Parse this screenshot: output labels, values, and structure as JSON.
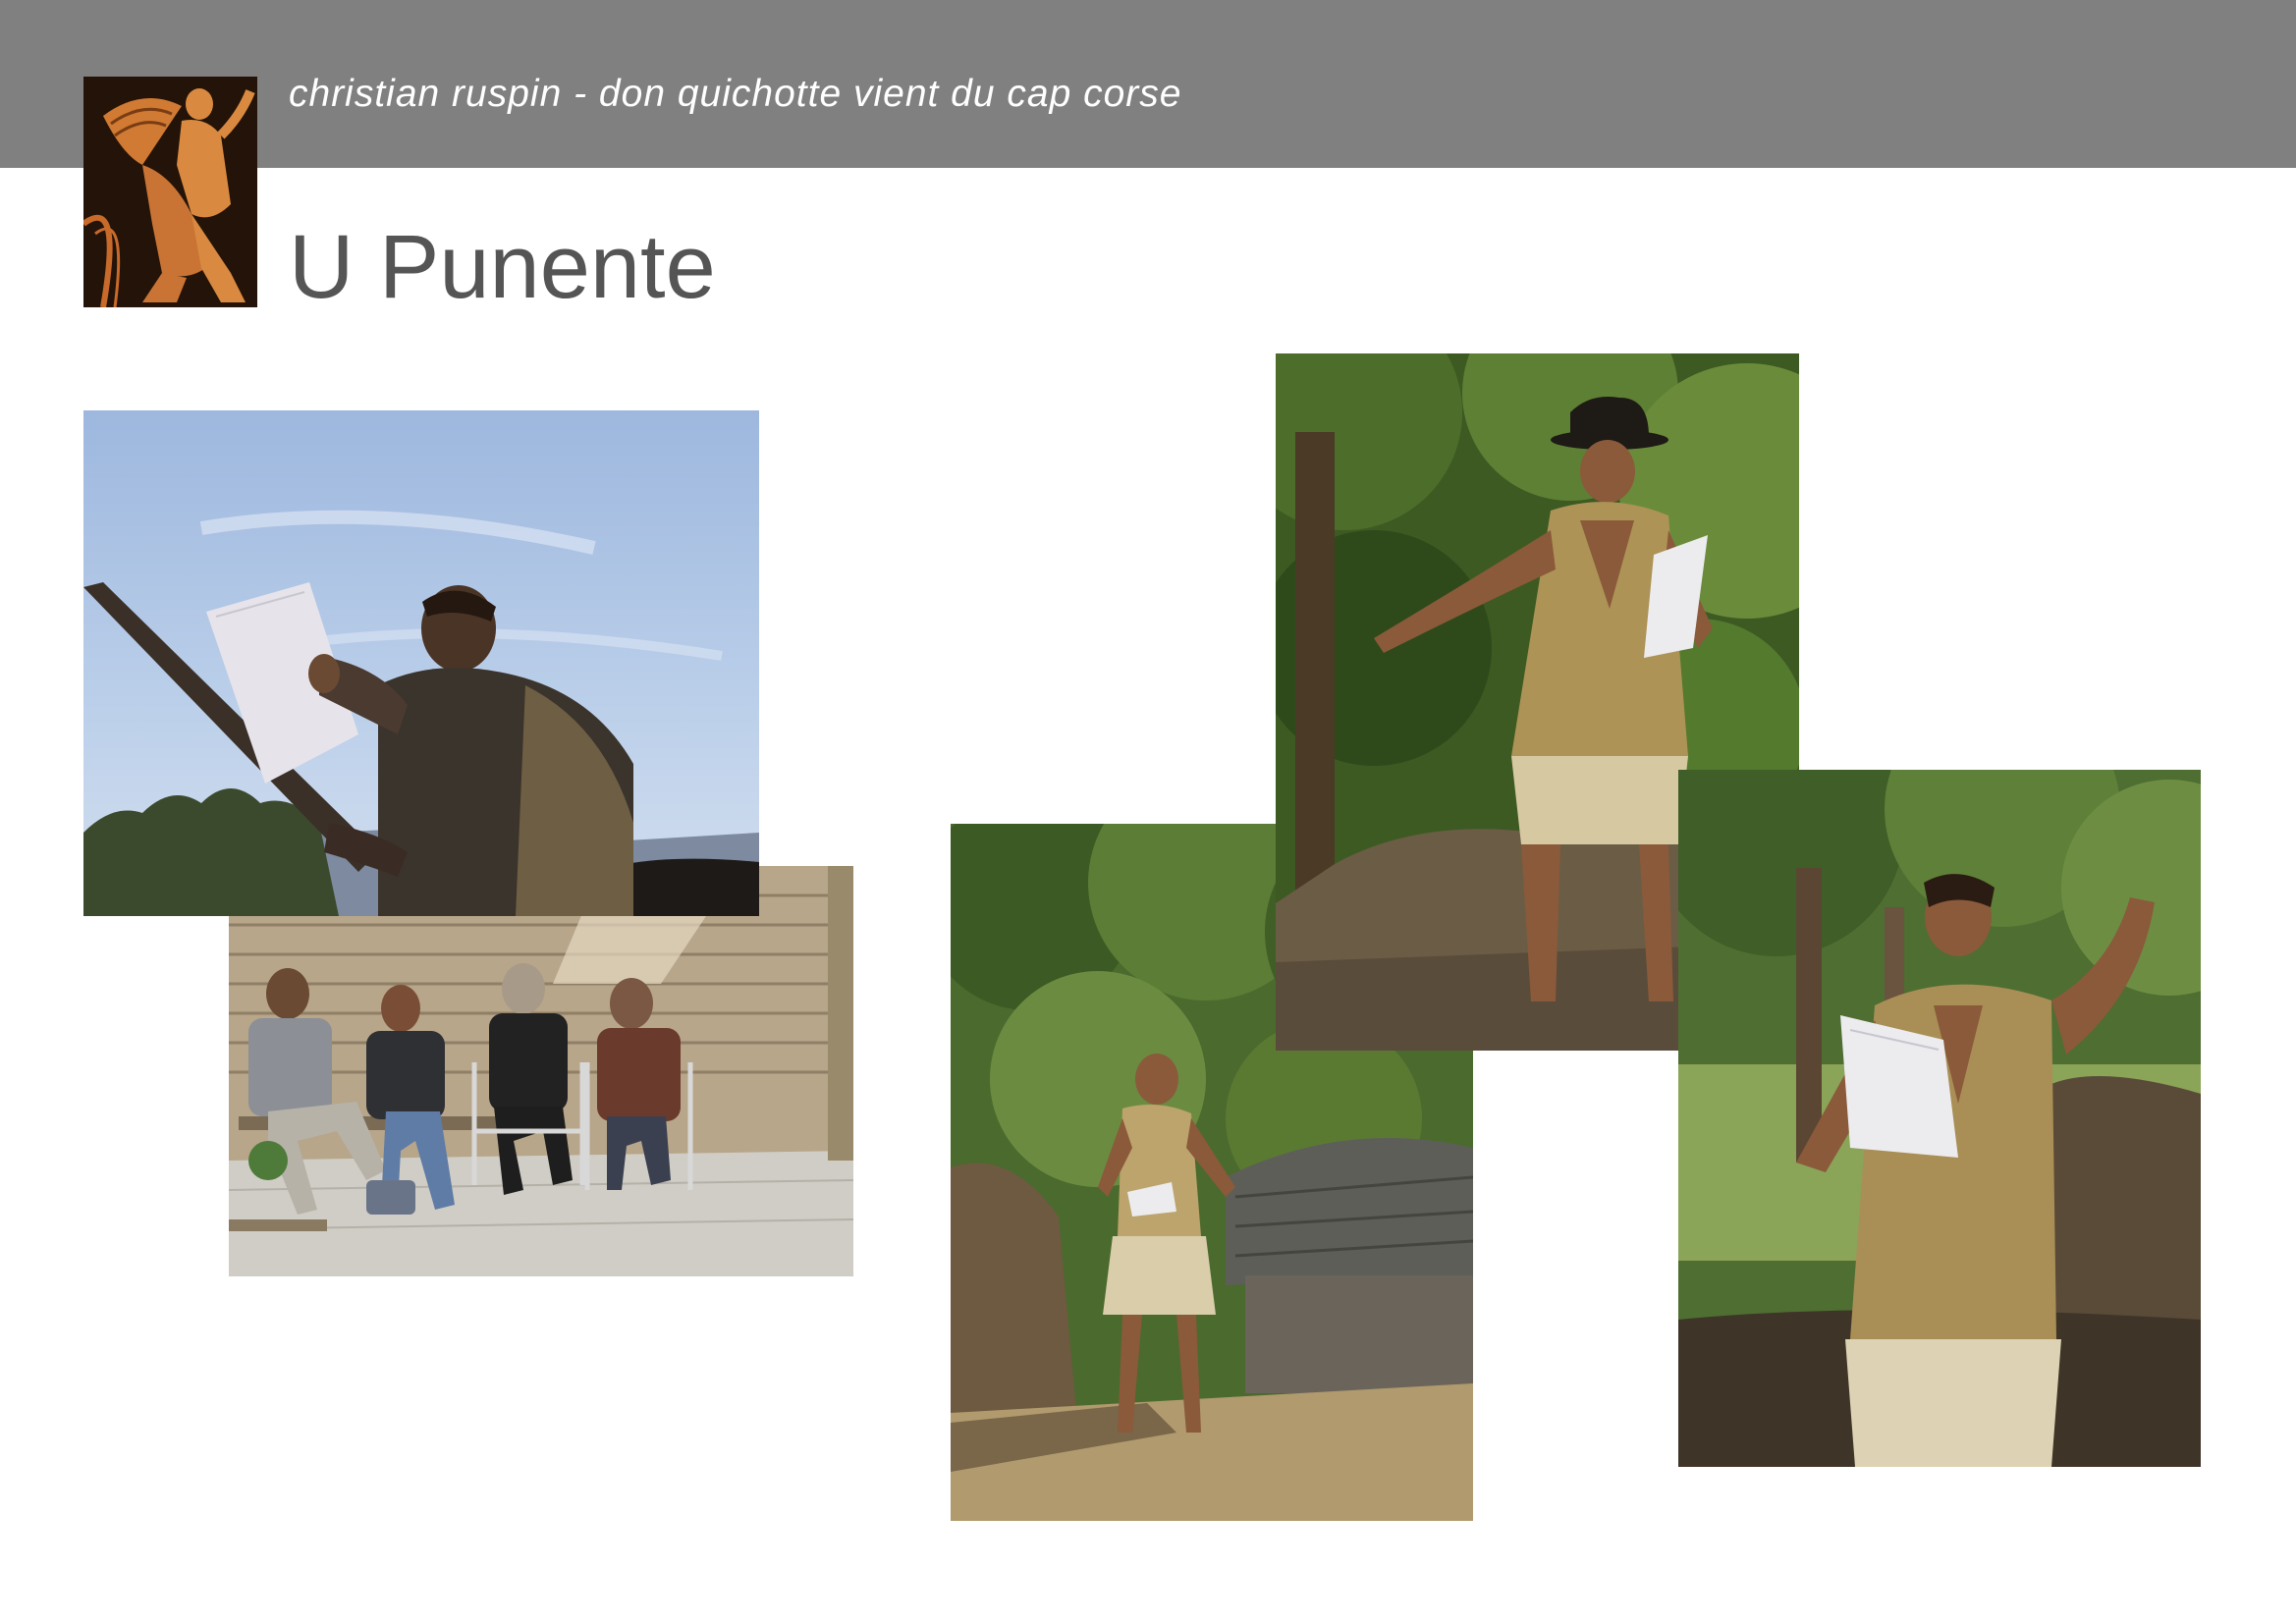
{
  "header": {
    "title": "christian ruspin - don quichotte vient du cap corse",
    "band_color": "#808080",
    "logo_icon": "greek-vase-figure-icon"
  },
  "page": {
    "title": "U Punente"
  },
  "photos": [
    {
      "name": "photo-reader-sky",
      "icon": "actor-reading-under-sky-photo"
    },
    {
      "name": "photo-seated-audience",
      "icon": "seated-audience-stone-wall-photo"
    },
    {
      "name": "photo-actor-hut",
      "icon": "actor-by-stone-hut-photo"
    },
    {
      "name": "photo-actor-hat",
      "icon": "actor-with-hat-forest-photo"
    },
    {
      "name": "photo-actor-tree",
      "icon": "actor-declaiming-tree-photo"
    }
  ]
}
